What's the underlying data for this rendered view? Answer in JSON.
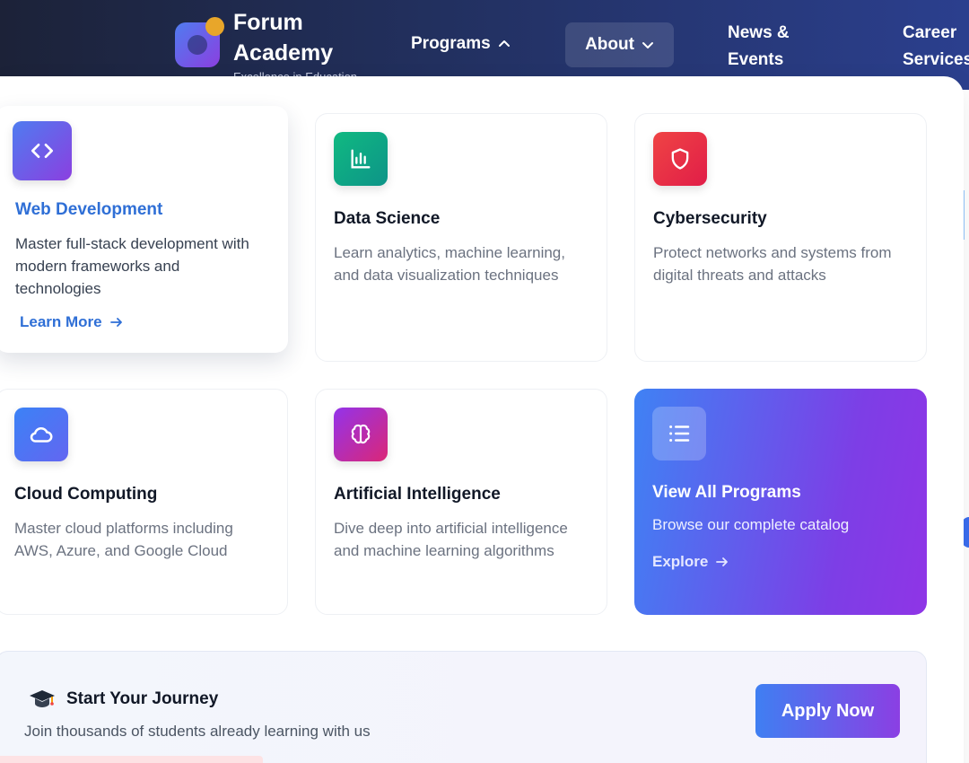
{
  "header": {
    "brand_line1": "Forum",
    "brand_line2": "Academy",
    "tagline": "Excellence in Education",
    "nav": {
      "programs": "Programs",
      "about": "About",
      "news_line1": "News &",
      "news_line2": "Events",
      "career_line1": "Career",
      "career_line2": "Services"
    }
  },
  "programs": [
    {
      "title": "Web Development",
      "desc": "Master full-stack development with modern frameworks and technologies",
      "link": "Learn More",
      "icon": "code-icon"
    },
    {
      "title": "Data Science",
      "desc": "Learn analytics, machine learning, and data visualization techniques",
      "icon": "bar-chart-icon"
    },
    {
      "title": "Cybersecurity",
      "desc": "Protect networks and systems from digital threats and attacks",
      "icon": "shield-icon"
    },
    {
      "title": "Cloud Computing",
      "desc": "Master cloud platforms including AWS, Azure, and Google Cloud",
      "icon": "cloud-icon"
    },
    {
      "title": "Artificial Intelligence",
      "desc": "Dive deep into artificial intelligence and machine learning algorithms",
      "icon": "brain-icon"
    }
  ],
  "view_all": {
    "title": "View All Programs",
    "desc": "Browse our complete catalog",
    "link": "Explore",
    "icon": "list-icon"
  },
  "cta": {
    "title": "Start Your Journey",
    "desc": "Join thousands of students already learning with us",
    "button": "Apply Now",
    "icon": "graduation-cap-icon"
  },
  "colors": {
    "accent_blue": "#2f6fd6",
    "gradient_start": "#3f82f4",
    "gradient_end": "#8f35e6"
  }
}
